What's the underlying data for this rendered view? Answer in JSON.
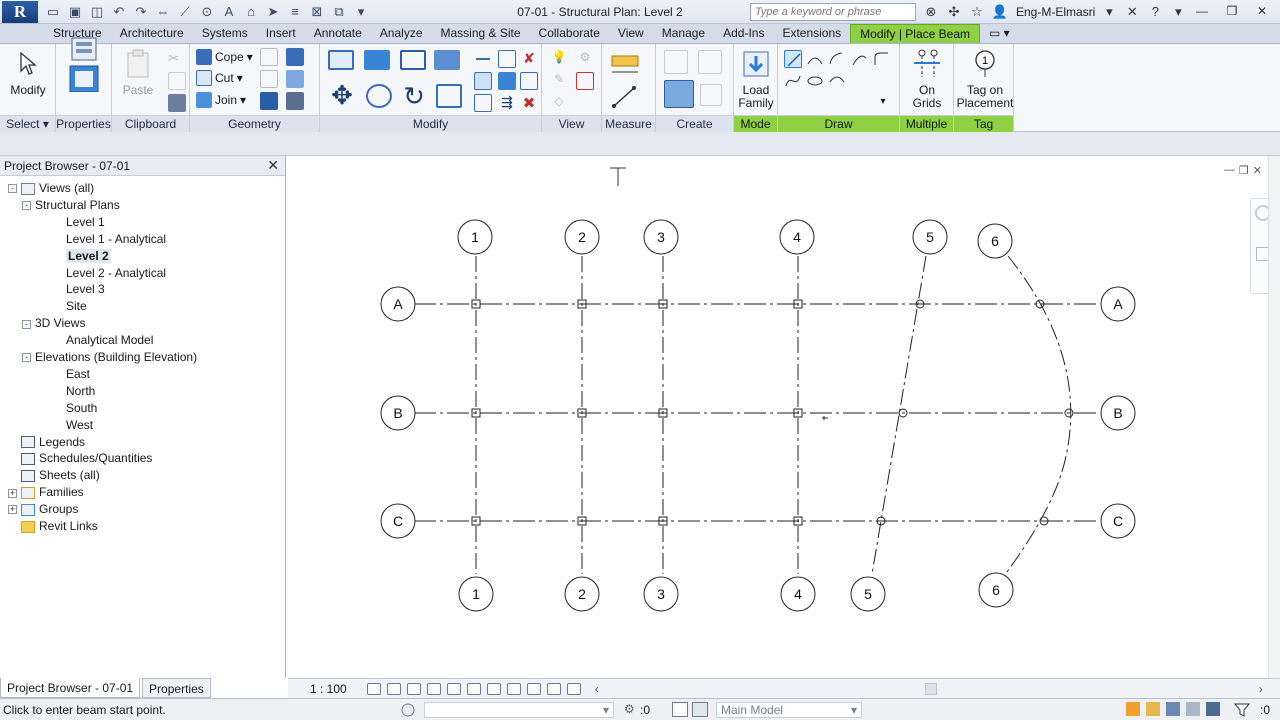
{
  "app": {
    "logo": "R",
    "title": "07-01 - Structural Plan: Level 2"
  },
  "search": {
    "placeholder": "Type a keyword or phrase"
  },
  "user": {
    "name": "Eng-M-Elmasri"
  },
  "tabs": [
    "Structure",
    "Architecture",
    "Systems",
    "Insert",
    "Annotate",
    "Analyze",
    "Massing & Site",
    "Collaborate",
    "View",
    "Manage",
    "Add-Ins",
    "Extensions",
    "Modify | Place Beam"
  ],
  "active_tab": "Modify | Place Beam",
  "ribbon": {
    "panels": {
      "select": "Select",
      "properties": "Properties",
      "clipboard": "Clipboard",
      "geometry": "Geometry",
      "modify": "Modify",
      "view": "View",
      "measure": "Measure",
      "create": "Create",
      "mode": "Mode",
      "draw": "Draw",
      "multiple": "Multiple",
      "tag": "Tag"
    },
    "buttons": {
      "modify": "Modify",
      "paste": "Paste",
      "cope": "Cope",
      "cut": "Cut",
      "join": "Join",
      "load_family_1": "Load",
      "load_family_2": "Family",
      "on_grids_1": "On",
      "on_grids_2": "Grids",
      "tag_1": "Tag on",
      "tag_2": "Placement"
    }
  },
  "browser": {
    "title": "Project Browser - 07-01",
    "tree": [
      {
        "label": "Views (all)",
        "level": 0,
        "expander": "-",
        "icon": "views-icon"
      },
      {
        "label": "Structural Plans",
        "level": 1,
        "expander": "-"
      },
      {
        "label": "Level 1",
        "level": 2
      },
      {
        "label": "Level 1 - Analytical",
        "level": 2
      },
      {
        "label": "Level 2",
        "level": 2,
        "selected": true
      },
      {
        "label": "Level 2 - Analytical",
        "level": 2
      },
      {
        "label": "Level 3",
        "level": 2
      },
      {
        "label": "Site",
        "level": 2
      },
      {
        "label": "3D Views",
        "level": 1,
        "expander": "-"
      },
      {
        "label": "Analytical Model",
        "level": 2
      },
      {
        "label": "Elevations (Building Elevation)",
        "level": 1,
        "expander": "-"
      },
      {
        "label": "East",
        "level": 2
      },
      {
        "label": "North",
        "level": 2
      },
      {
        "label": "South",
        "level": 2
      },
      {
        "label": "West",
        "level": 2
      },
      {
        "label": "Legends",
        "level": 0,
        "icon": "legends-icon"
      },
      {
        "label": "Schedules/Quantities",
        "level": 0,
        "icon": "schedules-icon"
      },
      {
        "label": "Sheets (all)",
        "level": 0,
        "icon": "sheets-icon"
      },
      {
        "label": "Families",
        "level": 0,
        "expander": "+",
        "icon": "families-icon"
      },
      {
        "label": "Groups",
        "level": 0,
        "expander": "+",
        "icon": "groups-icon"
      },
      {
        "label": "Revit Links",
        "level": 0,
        "icon": "links-icon"
      }
    ],
    "tab_browser": "Project Browser - 07-01",
    "tab_properties": "Properties"
  },
  "grids": {
    "vertical": [
      "1",
      "2",
      "3",
      "4",
      "5",
      "6"
    ],
    "horizontal": [
      "A",
      "B",
      "C"
    ]
  },
  "view_bar": {
    "scale": "1 : 100"
  },
  "status": {
    "message": "Click to enter beam start point.",
    "zero": ":0",
    "model": "Main Model",
    "filter_count": ":0"
  },
  "colors": {
    "active_tab": "#8fd045",
    "accent_blue": "#2c5fa8"
  }
}
